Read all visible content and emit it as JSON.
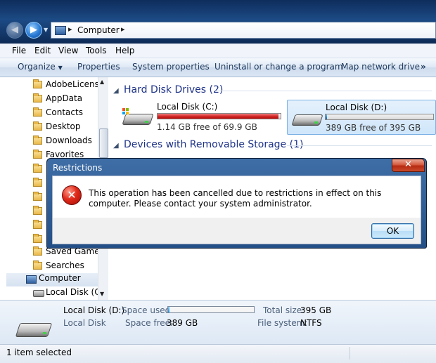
{
  "address": {
    "location": "Computer"
  },
  "menu": [
    "File",
    "Edit",
    "View",
    "Tools",
    "Help"
  ],
  "commands": {
    "organize": "Organize",
    "properties": "Properties",
    "system_properties": "System properties",
    "uninstall": "Uninstall or change a program",
    "map_drive": "Map network drive",
    "more": "»"
  },
  "nav_tree": [
    {
      "label": "AdobeLicensin",
      "type": "folder"
    },
    {
      "label": "AppData",
      "type": "folder"
    },
    {
      "label": "Contacts",
      "type": "folder"
    },
    {
      "label": "Desktop",
      "type": "folder"
    },
    {
      "label": "Downloads",
      "type": "folder"
    },
    {
      "label": "Favorites",
      "type": "folder"
    },
    {
      "label": "",
      "type": "folder"
    },
    {
      "label": "",
      "type": "folder"
    },
    {
      "label": "",
      "type": "folder"
    },
    {
      "label": "",
      "type": "folder"
    },
    {
      "label": "",
      "type": "folder"
    },
    {
      "label": "",
      "type": "folder"
    },
    {
      "label": "Saved Games",
      "type": "folder"
    },
    {
      "label": "Searches",
      "type": "folder"
    },
    {
      "label": "Computer",
      "type": "computer"
    },
    {
      "label": "Local Disk (C:)",
      "type": "disk"
    }
  ],
  "groups": {
    "hard_disks": "Hard Disk Drives (2)",
    "removable": "Devices with Removable Storage (1)"
  },
  "drives": [
    {
      "name": "Local Disk (C:)",
      "free": "1.14 GB free of 69.9 GB",
      "used_fraction": 0.984,
      "color": "#cf1f1f"
    },
    {
      "name": "Local Disk (D:)",
      "free": "389 GB free of 395 GB",
      "used_fraction": 0.015,
      "color": "#1f86d5"
    }
  ],
  "dialog": {
    "title": "Restrictions",
    "message": "This operation has been cancelled due to restrictions in effect on this computer. Please contact your system administrator.",
    "ok": "OK",
    "close": "✕"
  },
  "details": {
    "name": "Local Disk (D:)",
    "type": "Local Disk",
    "space_used_label": "Space used:",
    "space_free_label": "Space free:",
    "space_free": "389 GB",
    "total_label": "Total size:",
    "total": "395 GB",
    "fs_label": "File system:",
    "fs": "NTFS",
    "used_fraction": 0.015
  },
  "status": {
    "text": "1 item selected"
  }
}
